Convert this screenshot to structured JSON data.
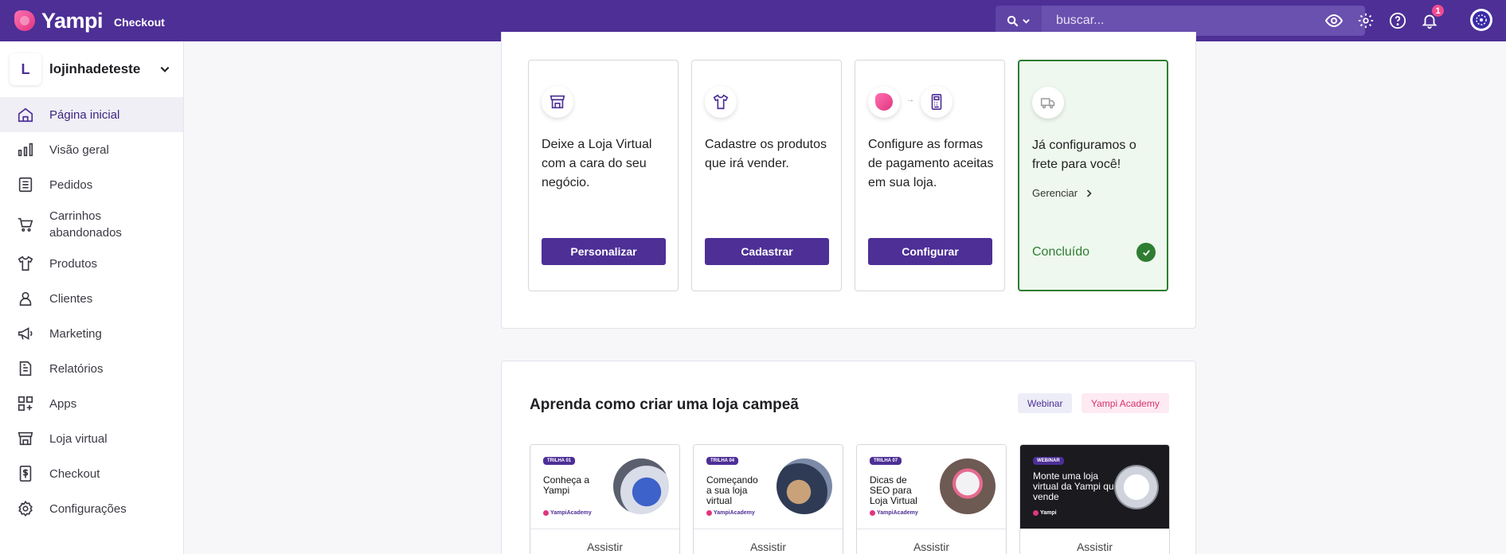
{
  "topbar": {
    "brand": "Yampi",
    "subtitle": "Checkout",
    "search_placeholder": "buscar...",
    "notification_count": "1"
  },
  "sidebar": {
    "store_letter": "L",
    "store_name": "lojinhadeteste",
    "items": [
      {
        "label": "Página inicial",
        "icon": "home-icon",
        "active": true
      },
      {
        "label": "Visão geral",
        "icon": "bar-chart-icon"
      },
      {
        "label": "Pedidos",
        "icon": "list-icon"
      },
      {
        "label": "Carrinhos abandonados",
        "icon": "cart-icon"
      },
      {
        "label": "Produtos",
        "icon": "shirt-icon"
      },
      {
        "label": "Clientes",
        "icon": "user-icon"
      },
      {
        "label": "Marketing",
        "icon": "megaphone-icon"
      },
      {
        "label": "Relatórios",
        "icon": "document-icon"
      },
      {
        "label": "Apps",
        "icon": "apps-icon"
      },
      {
        "label": "Loja virtual",
        "icon": "store-icon"
      },
      {
        "label": "Checkout",
        "icon": "receipt-icon"
      },
      {
        "label": "Configurações",
        "icon": "gear-icon"
      }
    ]
  },
  "steps": [
    {
      "text": "Deixe a Loja Virtual com a cara do seu negócio.",
      "button": "Personalizar"
    },
    {
      "text": "Cadastre os produtos que irá vender.",
      "button": "Cadastrar"
    },
    {
      "text": "Configure as formas de pagamento aceitas em sua loja.",
      "button": "Configurar"
    },
    {
      "text": "Já configuramos o frete para você!",
      "link": "Gerenciar",
      "status": "Concluído"
    }
  ],
  "learn": {
    "title": "Aprenda como criar uma loja campeã",
    "tags": [
      "Webinar",
      "Yampi Academy"
    ],
    "videos": [
      {
        "tag": "TRILHA 01",
        "title": "Conheça a Yampi",
        "brand": "YampiAcademy",
        "action": "Assistir"
      },
      {
        "tag": "TRILHA 04",
        "title": "Começando a sua loja virtual",
        "brand": "YampiAcademy",
        "action": "Assistir"
      },
      {
        "tag": "TRILHA 07",
        "title": "Dicas de SEO para Loja Virtual",
        "brand": "YampiAcademy",
        "action": "Assistir"
      },
      {
        "tag": "WEBINAR",
        "title": "Monte uma loja virtual da Yampi que vende",
        "brand": "Yampi",
        "action": "Assistir"
      }
    ]
  },
  "colors": {
    "primary": "#4d2f96",
    "success": "#2e7d32",
    "accent_pink": "#e0357f"
  }
}
